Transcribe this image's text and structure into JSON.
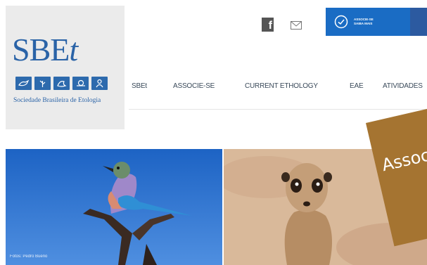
{
  "logo": {
    "main": "SBE",
    "italic": "t",
    "subtitle": "Sociedade Brasileira de Etologia",
    "icons": [
      "bird-icon",
      "plant-icon",
      "fish-icon",
      "snail-icon",
      "primate-icon"
    ]
  },
  "topbar": {
    "facebook_glyph": "f",
    "cta_line1": "ASSOCIE-SE",
    "cta_line2": "SAIBA MAIS"
  },
  "nav": {
    "items": [
      "SBEt",
      "ASSOCIE-SE",
      "CURRENT ETHOLOGY",
      "EAE",
      "ATIVIDADES"
    ]
  },
  "hero": {
    "photo_credit": "Fotos: Pedro Bueno"
  },
  "banner": {
    "text": "Associe-se"
  },
  "colors": {
    "brand_blue": "#2a63a7",
    "cta_blue": "#1a6cc4",
    "banner_brown": "#a57431"
  }
}
